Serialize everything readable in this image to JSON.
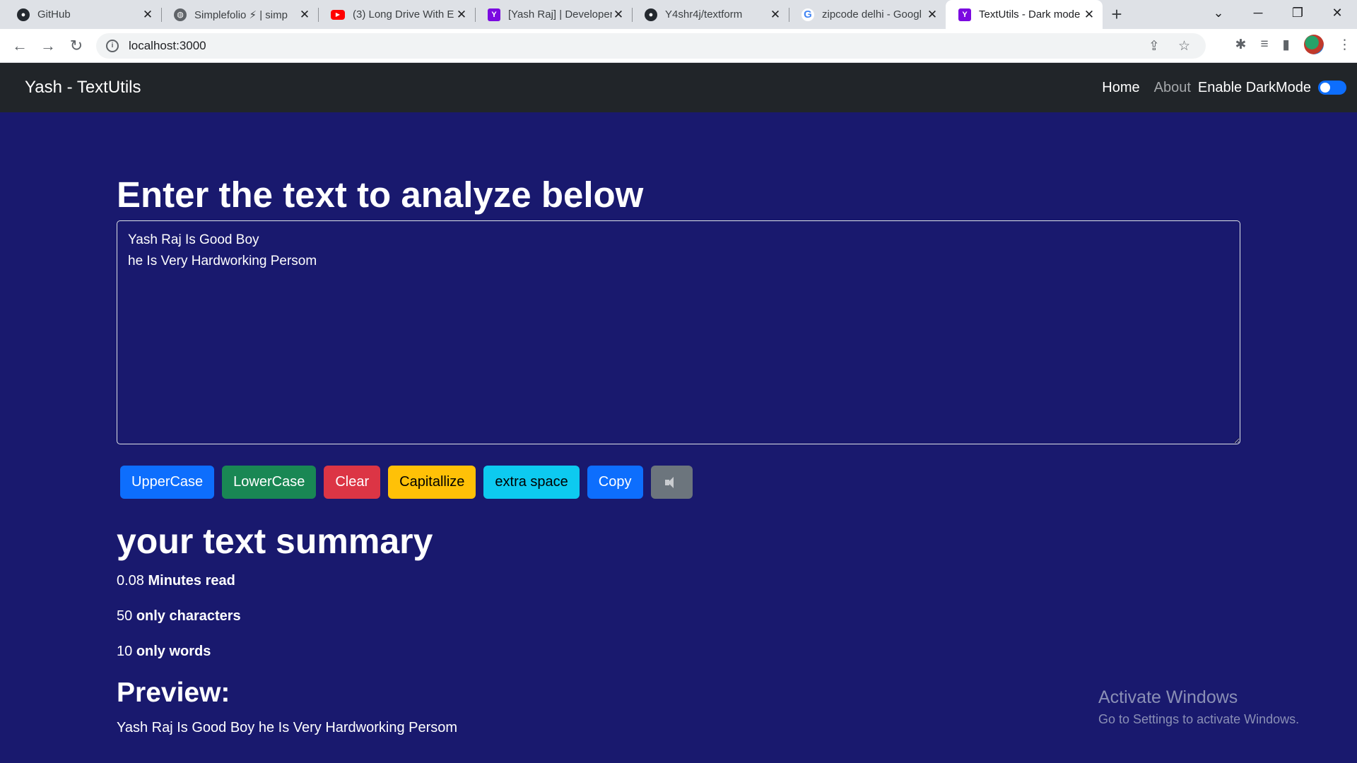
{
  "browser": {
    "tabs": [
      {
        "title": "GitHub",
        "icon": "github-icon"
      },
      {
        "title": "Simplefolio ⚡ | simp",
        "icon": "globe-icon"
      },
      {
        "title": "(3) Long Drive With E",
        "icon": "youtube-icon"
      },
      {
        "title": "[Yash Raj] | Developer",
        "icon": "yahoo-icon"
      },
      {
        "title": "Y4shr4j/textform",
        "icon": "github-icon"
      },
      {
        "title": "zipcode delhi - Googl",
        "icon": "google-icon"
      },
      {
        "title": "TextUtils - Dark mode",
        "icon": "yahoo-icon",
        "active": true
      }
    ],
    "url": "localhost:3000"
  },
  "navbar": {
    "brand": "Yash - TextUtils",
    "home": "Home",
    "about": "About",
    "dark_mode_label": "Enable DarkMode",
    "dark_mode_on": true
  },
  "main": {
    "heading": "Enter the text to analyze below",
    "textarea_value": "Yash Raj Is Good Boy\nhe Is Very Hardworking Persom",
    "buttons": {
      "uppercase": "UpperCase",
      "lowercase": "LowerCase",
      "clear": "Clear",
      "capitalize": "Capitallize",
      "extra_space": "extra space",
      "copy": "Copy"
    },
    "summary_heading": "your text summary",
    "minutes_value": "0.08",
    "minutes_label": "Minutes read",
    "chars_value": "50",
    "chars_label": "only characters",
    "words_value": "10",
    "words_label": "only words",
    "preview_heading": "Preview:",
    "preview_text": "Yash Raj Is Good Boy he Is Very Hardworking Persom"
  },
  "watermark": {
    "line1": "Activate Windows",
    "line2": "Go to Settings to activate Windows."
  },
  "colors": {
    "navbar_bg": "#212529",
    "main_bg": "#19196e",
    "primary": "#0d6efd",
    "success": "#198754",
    "danger": "#dc3545",
    "warning": "#ffc107",
    "info": "#0dcaf0",
    "secondary": "#6c757d"
  }
}
